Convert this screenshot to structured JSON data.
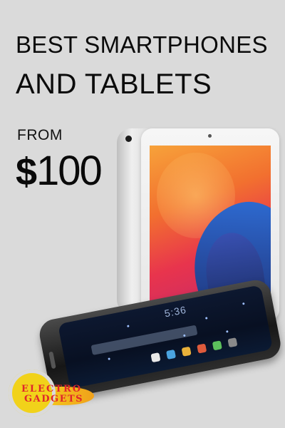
{
  "headline": {
    "line1": "BEST SMARTPHONES",
    "line2": "AND TABLETS"
  },
  "price": {
    "from_label": "FROM",
    "currency": "$",
    "amount": "100"
  },
  "phone": {
    "clock": "5:36"
  },
  "logo": {
    "line1": "ELECTRO",
    "line2": "GADGETS"
  },
  "colors": {
    "background": "#dadada",
    "text": "#0b0b0b",
    "logo_yellow": "#f1d21a",
    "logo_red": "#e0262b"
  }
}
